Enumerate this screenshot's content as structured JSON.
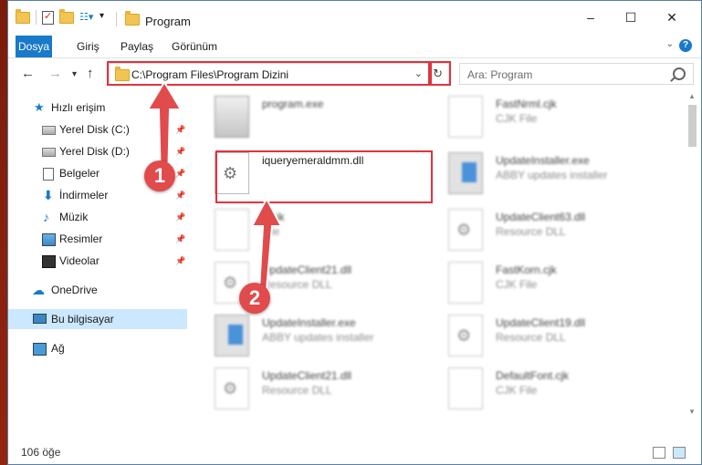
{
  "window": {
    "title": "Program",
    "controls": {
      "minimize": "–",
      "maximize": "☐",
      "close": "✕"
    }
  },
  "ribbon": {
    "tabs": [
      "Dosya",
      "Giriş",
      "Paylaş",
      "Görünüm"
    ],
    "help": "?"
  },
  "nav": {
    "back": "←",
    "forward": "→",
    "recent": "▾",
    "up": "↑",
    "address": "C:\\Program Files\\Program Dizini",
    "dropdown": "⌄",
    "refresh": "↻",
    "search_placeholder": "Ara: Program"
  },
  "sidebar": {
    "items": [
      {
        "label": "Hızlı erişim",
        "icon": "star-icon",
        "pinned": false
      },
      {
        "label": "Yerel Disk (C:)",
        "icon": "disk-icon",
        "pinned": true
      },
      {
        "label": "Yerel Disk (D:)",
        "icon": "disk-icon",
        "pinned": true
      },
      {
        "label": "Belgeler",
        "icon": "documents-icon",
        "pinned": true
      },
      {
        "label": "İndirmeler",
        "icon": "download-icon",
        "pinned": true
      },
      {
        "label": "Müzik",
        "icon": "music-icon",
        "pinned": true
      },
      {
        "label": "Resimler",
        "icon": "pictures-icon",
        "pinned": true
      },
      {
        "label": "Videolar",
        "icon": "videos-icon",
        "pinned": true
      },
      {
        "label": "OneDrive",
        "icon": "cloud-icon",
        "pinned": false
      },
      {
        "label": "Bu bilgisayar",
        "icon": "computer-icon",
        "pinned": false,
        "selected": true
      },
      {
        "label": "Ağ",
        "icon": "network-icon",
        "pinned": false
      }
    ],
    "pin_glyph": "📌"
  },
  "files": [
    {
      "name": "program.exe",
      "type": "",
      "icon": "app",
      "blur": true
    },
    {
      "name": "FastNrml.cjk",
      "type": "CJK File",
      "icon": "doc",
      "blur": true
    },
    {
      "name": "iqueryemeraldmm.dll",
      "type": "",
      "icon": "dll",
      "blur": false,
      "highlighted": true
    },
    {
      "name": "UpdateInstaller.exe",
      "type": "ABBY updates installer",
      "icon": "exe",
      "blur": true
    },
    {
      "name": "d.cjk",
      "type": "File",
      "icon": "doc",
      "blur": true
    },
    {
      "name": "UpdateClient63.dll",
      "type": "Resource DLL",
      "icon": "dll",
      "blur": true
    },
    {
      "name": "UpdateClient21.dll",
      "type": "Resource DLL",
      "icon": "dll",
      "blur": true
    },
    {
      "name": "FastKorn.cjk",
      "type": "CJK File",
      "icon": "doc",
      "blur": true
    },
    {
      "name": "UpdateInstaller.exe",
      "type": "ABBY updates installer",
      "icon": "exe",
      "blur": true
    },
    {
      "name": "UpdateClient19.dll",
      "type": "Resource DLL",
      "icon": "dll",
      "blur": true
    },
    {
      "name": "UpdateClient21.dll",
      "type": "Resource DLL",
      "icon": "dll",
      "blur": true
    },
    {
      "name": "DefaultFont.cjk",
      "type": "CJK File",
      "icon": "doc",
      "blur": true
    }
  ],
  "status": {
    "count": "106 öğe"
  },
  "annotations": {
    "step1": "1",
    "step2": "2"
  },
  "colors": {
    "accent": "#1979ca",
    "highlight": "#e0343e",
    "badge": "#e14b4b"
  }
}
